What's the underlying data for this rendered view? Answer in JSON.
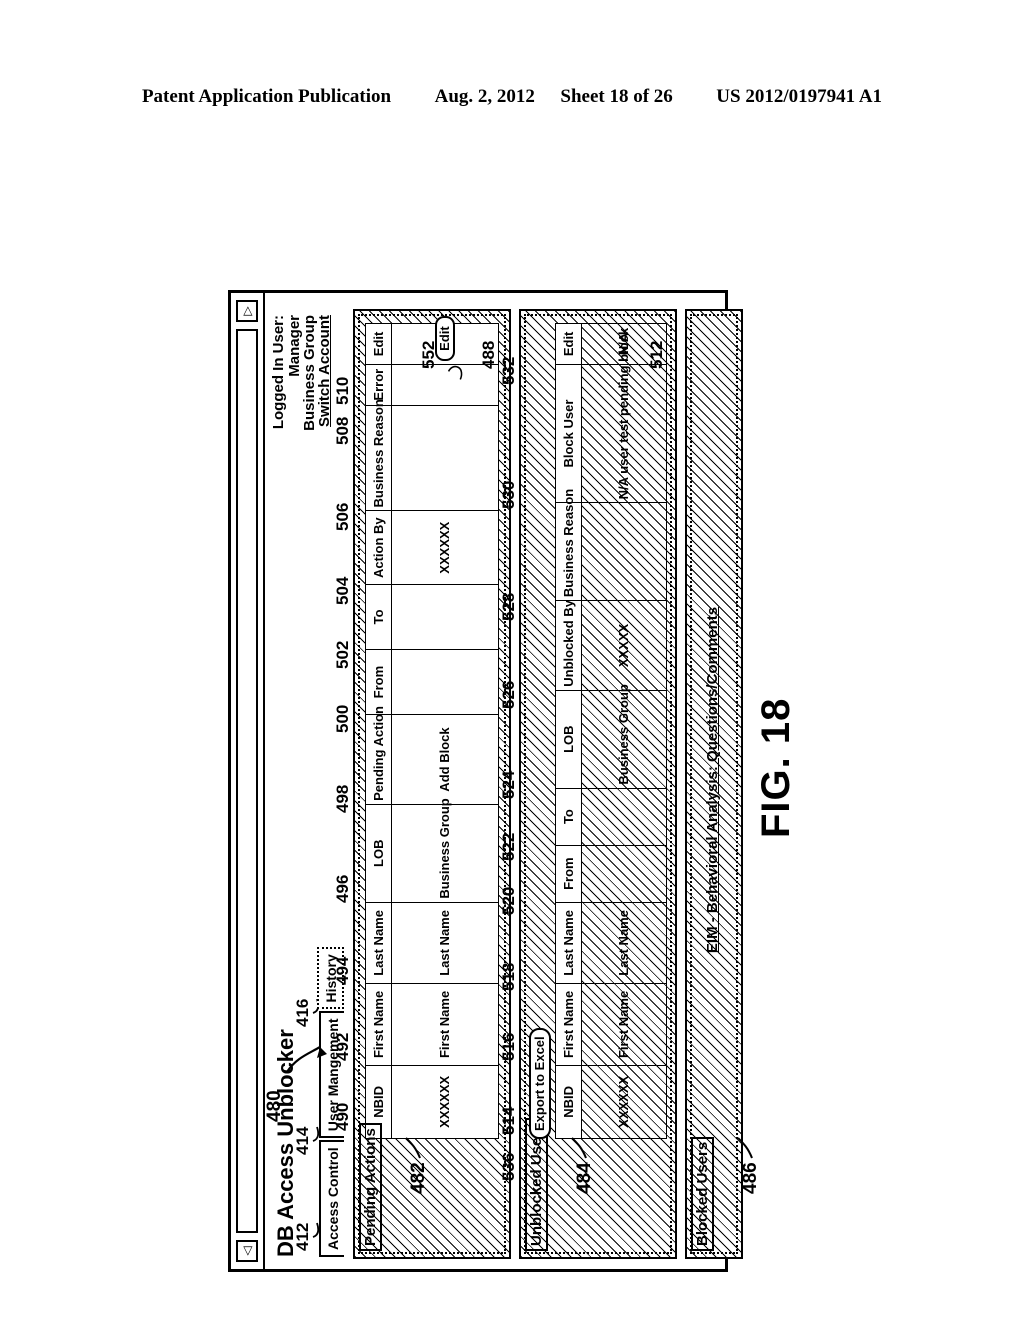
{
  "publication_header": {
    "left": "Patent Application Publication",
    "date": "Aug. 2, 2012",
    "sheet": "Sheet 18 of 26",
    "number": "US 2012/0197941 A1"
  },
  "figure": {
    "caption": "FIG. 18",
    "window_ref": "480"
  },
  "window": {
    "back_arrow": "◁",
    "forward_arrow": "▷",
    "address_value": ""
  },
  "app": {
    "title": "DB Access Unblocker",
    "logged_in": {
      "label": "Logged In User:",
      "role": "Manager",
      "group": "Business Group",
      "switch_account": "Switch Account"
    },
    "tabs": [
      {
        "label": "Access Control",
        "ref": "412"
      },
      {
        "label": "User Mangement",
        "ref": "414"
      },
      {
        "label": "History",
        "ref": "416"
      }
    ],
    "footer_link": "EIM - Behavioral Analysis: Questions/Comments"
  },
  "panels": {
    "pending": {
      "title": "Pending Actions",
      "ref": "482",
      "table_ref": "488",
      "edit_button_ref": "552",
      "columns": [
        {
          "label": "NBID",
          "ref": "490"
        },
        {
          "label": "First Name",
          "ref": "492"
        },
        {
          "label": "Last Name",
          "ref": "494"
        },
        {
          "label": "LOB",
          "ref": "496"
        },
        {
          "label": "Pending Action",
          "ref": "498"
        },
        {
          "label": "From",
          "ref": "500"
        },
        {
          "label": "To",
          "ref": "502"
        },
        {
          "label": "Action By",
          "ref": "504"
        },
        {
          "label": "Business Reason",
          "ref": "506"
        },
        {
          "label": "Error",
          "ref": "508"
        },
        {
          "label": "Edit",
          "ref": "510"
        }
      ],
      "rows": [
        {
          "nbid": "XXXXXX",
          "first_name": "First Name",
          "last_name": "Last Name",
          "lob": "Business Group",
          "pending_action": "Add Block",
          "from": "",
          "to": "",
          "action_by": "XXXXXX",
          "business_reason": "",
          "error": "",
          "edit": "Edit"
        }
      ]
    },
    "unblocked": {
      "title": "Unblocked Users",
      "ref": "484",
      "table_ref": "512",
      "export_button": {
        "label": "Export to Excel",
        "ref": "536"
      },
      "columns": [
        {
          "label": "NBID",
          "ref": "514"
        },
        {
          "label": "First Name",
          "ref": "516"
        },
        {
          "label": "Last Name",
          "ref": "518"
        },
        {
          "label": "From",
          "ref": "520"
        },
        {
          "label": "To",
          "ref": "522"
        },
        {
          "label": "LOB",
          "ref": "524"
        },
        {
          "label": "Unblocked By",
          "ref": "526"
        },
        {
          "label": "Business Reason",
          "ref": "528"
        },
        {
          "label": "Block User",
          "ref": "530"
        },
        {
          "label": "Edit",
          "ref": "532"
        }
      ],
      "rows": [
        {
          "nbid": "XXXXXX",
          "first_name": "First Name",
          "last_name": "Last Name",
          "from": "",
          "to": "",
          "lob": "Business Group",
          "unblocked_by": "XXXXX",
          "business_reason": "",
          "block_user": "N/A user test pending block",
          "edit": "N/A"
        }
      ]
    },
    "blocked": {
      "title": "Blocked Users",
      "ref": "486"
    }
  }
}
